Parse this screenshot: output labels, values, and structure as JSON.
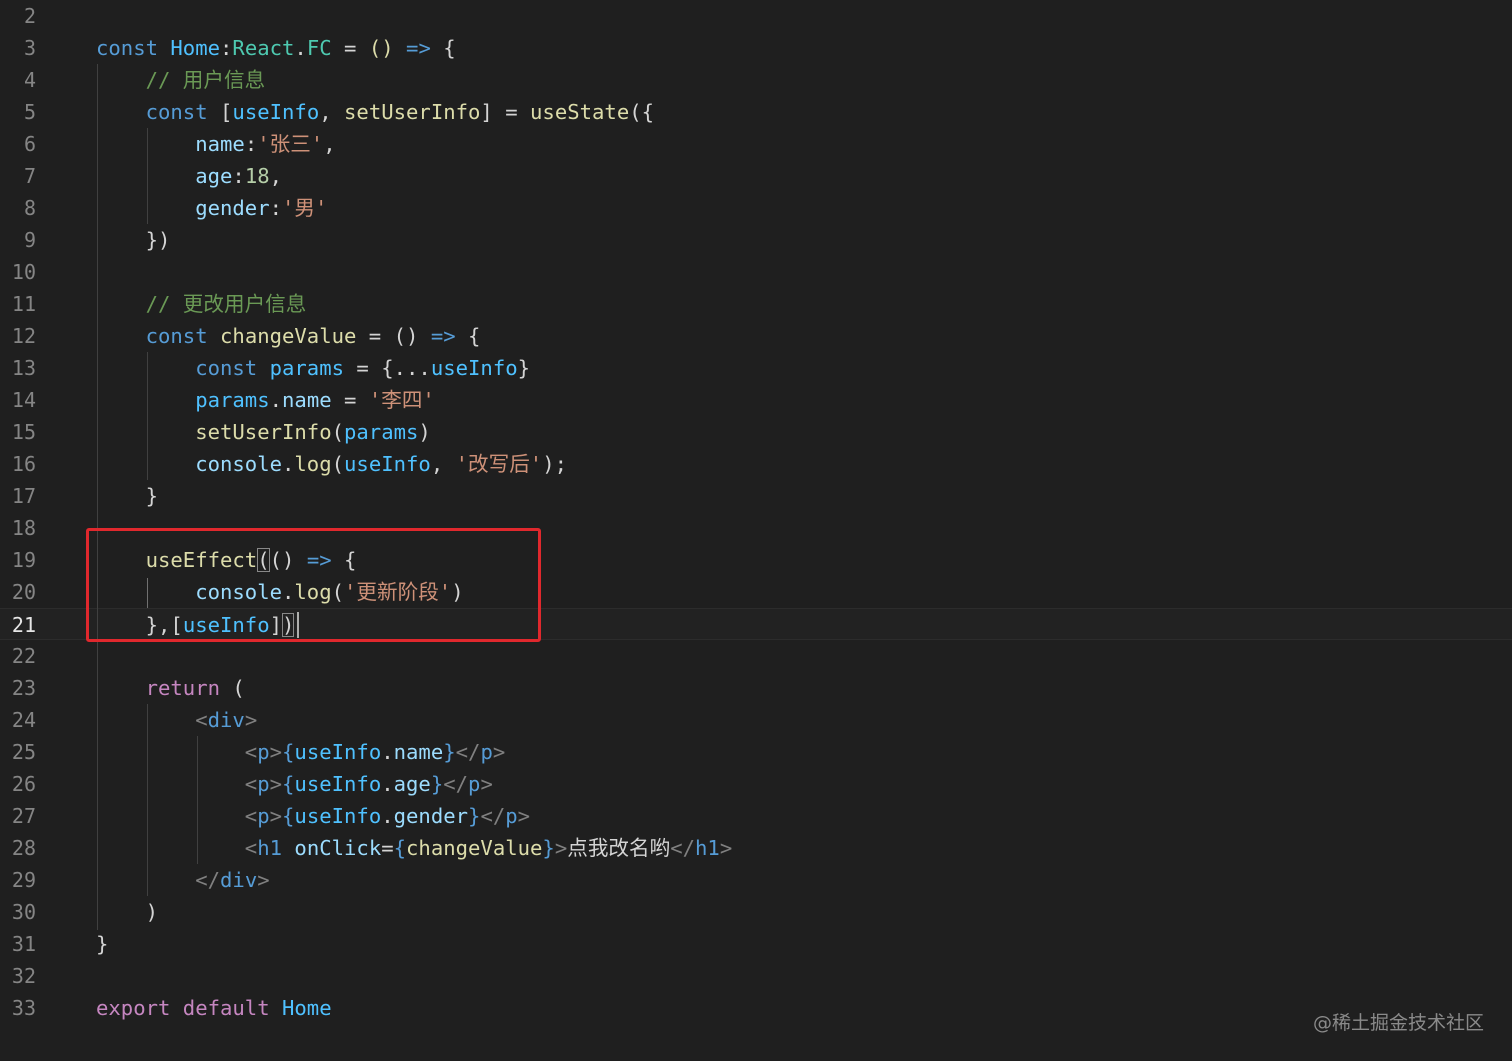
{
  "editor": {
    "lines": [
      {
        "num": "2",
        "tokens": []
      },
      {
        "num": "3",
        "tokens": [
          [
            "const ",
            "kw"
          ],
          [
            "Home",
            "cn"
          ],
          [
            ":",
            "pn"
          ],
          [
            "React",
            "ty"
          ],
          [
            ".",
            "pn"
          ],
          [
            "FC",
            "ty"
          ],
          [
            " = ",
            "pn"
          ],
          [
            "()",
            "fn"
          ],
          [
            " => ",
            "kw"
          ],
          [
            "{",
            "pn"
          ]
        ]
      },
      {
        "num": "4",
        "tokens": [
          [
            "    ",
            "pn"
          ],
          [
            "// 用户信息",
            "cm"
          ]
        ]
      },
      {
        "num": "5",
        "tokens": [
          [
            "    ",
            "pn"
          ],
          [
            "const ",
            "kw"
          ],
          [
            "[",
            "pn"
          ],
          [
            "useInfo",
            "cn"
          ],
          [
            ", ",
            "pn"
          ],
          [
            "setUserInfo",
            "fn"
          ],
          [
            "] = ",
            "pn"
          ],
          [
            "useState",
            "fn"
          ],
          [
            "({",
            "pn"
          ]
        ]
      },
      {
        "num": "6",
        "tokens": [
          [
            "        ",
            "pn"
          ],
          [
            "name",
            "vr"
          ],
          [
            ":",
            "pn"
          ],
          [
            "'张三'",
            "str"
          ],
          [
            ",",
            "pn"
          ]
        ]
      },
      {
        "num": "7",
        "tokens": [
          [
            "        ",
            "pn"
          ],
          [
            "age",
            "vr"
          ],
          [
            ":",
            "pn"
          ],
          [
            "18",
            "num"
          ],
          [
            ",",
            "pn"
          ]
        ]
      },
      {
        "num": "8",
        "tokens": [
          [
            "        ",
            "pn"
          ],
          [
            "gender",
            "vr"
          ],
          [
            ":",
            "pn"
          ],
          [
            "'男'",
            "str"
          ]
        ]
      },
      {
        "num": "9",
        "tokens": [
          [
            "    ",
            "pn"
          ],
          [
            "})",
            "pn"
          ]
        ]
      },
      {
        "num": "10",
        "tokens": []
      },
      {
        "num": "11",
        "tokens": [
          [
            "    ",
            "pn"
          ],
          [
            "// 更改用户信息",
            "cm"
          ]
        ]
      },
      {
        "num": "12",
        "tokens": [
          [
            "    ",
            "pn"
          ],
          [
            "const ",
            "kw"
          ],
          [
            "changeValue",
            "fn"
          ],
          [
            " = ",
            "pn"
          ],
          [
            "()",
            "pn"
          ],
          [
            " => ",
            "kw"
          ],
          [
            "{",
            "pn"
          ]
        ]
      },
      {
        "num": "13",
        "tokens": [
          [
            "        ",
            "pn"
          ],
          [
            "const ",
            "kw"
          ],
          [
            "params",
            "cn"
          ],
          [
            " = {",
            "pn"
          ],
          [
            "...",
            "pn"
          ],
          [
            "useInfo",
            "cn"
          ],
          [
            "}",
            "pn"
          ]
        ]
      },
      {
        "num": "14",
        "tokens": [
          [
            "        ",
            "pn"
          ],
          [
            "params",
            "cn"
          ],
          [
            ".",
            "pn"
          ],
          [
            "name",
            "vr"
          ],
          [
            " = ",
            "pn"
          ],
          [
            "'李四'",
            "str"
          ]
        ]
      },
      {
        "num": "15",
        "tokens": [
          [
            "        ",
            "pn"
          ],
          [
            "setUserInfo",
            "fn"
          ],
          [
            "(",
            "pn"
          ],
          [
            "params",
            "cn"
          ],
          [
            ")",
            "pn"
          ]
        ]
      },
      {
        "num": "16",
        "tokens": [
          [
            "        ",
            "pn"
          ],
          [
            "console",
            "vr"
          ],
          [
            ".",
            "pn"
          ],
          [
            "log",
            "fn"
          ],
          [
            "(",
            "pn"
          ],
          [
            "useInfo",
            "cn"
          ],
          [
            ", ",
            "pn"
          ],
          [
            "'改写后'",
            "str"
          ],
          [
            ");",
            "pn"
          ]
        ]
      },
      {
        "num": "17",
        "tokens": [
          [
            "    ",
            "pn"
          ],
          [
            "}",
            "pn"
          ]
        ]
      },
      {
        "num": "18",
        "tokens": []
      },
      {
        "num": "19",
        "tokens": [
          [
            "    ",
            "pn"
          ],
          [
            "useEffect",
            "fn"
          ],
          [
            "(",
            "pn bmatch"
          ],
          [
            "()",
            "pn"
          ],
          [
            " => ",
            "kw"
          ],
          [
            "{",
            "pn"
          ]
        ]
      },
      {
        "num": "20",
        "tokens": [
          [
            "        ",
            "pn"
          ],
          [
            "console",
            "vr"
          ],
          [
            ".",
            "pn"
          ],
          [
            "log",
            "fn"
          ],
          [
            "(",
            "pn"
          ],
          [
            "'更新阶段'",
            "str"
          ],
          [
            ")",
            "pn"
          ]
        ]
      },
      {
        "num": "21",
        "tokens": [
          [
            "    ",
            "pn"
          ],
          [
            "},[",
            "pn"
          ],
          [
            "useInfo",
            "cn"
          ],
          [
            "]",
            "pn"
          ],
          [
            ")",
            "pn bmatch"
          ]
        ]
      },
      {
        "num": "22",
        "tokens": []
      },
      {
        "num": "23",
        "tokens": [
          [
            "    ",
            "pn"
          ],
          [
            "return",
            "kwc"
          ],
          [
            " (",
            "pn"
          ]
        ]
      },
      {
        "num": "24",
        "tokens": [
          [
            "        ",
            "pn"
          ],
          [
            "<",
            "tag"
          ],
          [
            "div",
            "tn"
          ],
          [
            ">",
            "tag"
          ]
        ]
      },
      {
        "num": "25",
        "tokens": [
          [
            "            ",
            "pn"
          ],
          [
            "<",
            "tag"
          ],
          [
            "p",
            "tn"
          ],
          [
            ">",
            "tag"
          ],
          [
            "{",
            "tn"
          ],
          [
            "useInfo",
            "cn"
          ],
          [
            ".",
            "pn"
          ],
          [
            "name",
            "vr"
          ],
          [
            "}",
            "tn"
          ],
          [
            "</",
            "tag"
          ],
          [
            "p",
            "tn"
          ],
          [
            ">",
            "tag"
          ]
        ]
      },
      {
        "num": "26",
        "tokens": [
          [
            "            ",
            "pn"
          ],
          [
            "<",
            "tag"
          ],
          [
            "p",
            "tn"
          ],
          [
            ">",
            "tag"
          ],
          [
            "{",
            "tn"
          ],
          [
            "useInfo",
            "cn"
          ],
          [
            ".",
            "pn"
          ],
          [
            "age",
            "vr"
          ],
          [
            "}",
            "tn"
          ],
          [
            "</",
            "tag"
          ],
          [
            "p",
            "tn"
          ],
          [
            ">",
            "tag"
          ]
        ]
      },
      {
        "num": "27",
        "tokens": [
          [
            "            ",
            "pn"
          ],
          [
            "<",
            "tag"
          ],
          [
            "p",
            "tn"
          ],
          [
            ">",
            "tag"
          ],
          [
            "{",
            "tn"
          ],
          [
            "useInfo",
            "cn"
          ],
          [
            ".",
            "pn"
          ],
          [
            "gender",
            "vr"
          ],
          [
            "}",
            "tn"
          ],
          [
            "</",
            "tag"
          ],
          [
            "p",
            "tn"
          ],
          [
            ">",
            "tag"
          ]
        ]
      },
      {
        "num": "28",
        "tokens": [
          [
            "            ",
            "pn"
          ],
          [
            "<",
            "tag"
          ],
          [
            "h1",
            "tn"
          ],
          [
            " ",
            "pn"
          ],
          [
            "onClick",
            "at"
          ],
          [
            "=",
            "pn"
          ],
          [
            "{",
            "tn"
          ],
          [
            "changeValue",
            "fn"
          ],
          [
            "}",
            "tn"
          ],
          [
            ">",
            "tag"
          ],
          [
            "点我改名哟",
            "pn"
          ],
          [
            "</",
            "tag"
          ],
          [
            "h1",
            "tn"
          ],
          [
            ">",
            "tag"
          ]
        ]
      },
      {
        "num": "29",
        "tokens": [
          [
            "        ",
            "pn"
          ],
          [
            "</",
            "tag"
          ],
          [
            "div",
            "tn"
          ],
          [
            ">",
            "tag"
          ]
        ]
      },
      {
        "num": "30",
        "tokens": [
          [
            "    ",
            "pn"
          ],
          [
            ")",
            "pn"
          ]
        ]
      },
      {
        "num": "31",
        "tokens": [
          [
            "}",
            "pn"
          ]
        ]
      },
      {
        "num": "32",
        "tokens": []
      },
      {
        "num": "33",
        "tokens": [
          [
            "export ",
            "kwc"
          ],
          [
            "default ",
            "kwc"
          ],
          [
            "Home",
            "cn"
          ]
        ]
      }
    ],
    "active_line": "21"
  },
  "watermark": "@稀土掘金技术社区",
  "colors": {
    "background": "#1f1f1f",
    "highlight_box": "#e0282d"
  }
}
